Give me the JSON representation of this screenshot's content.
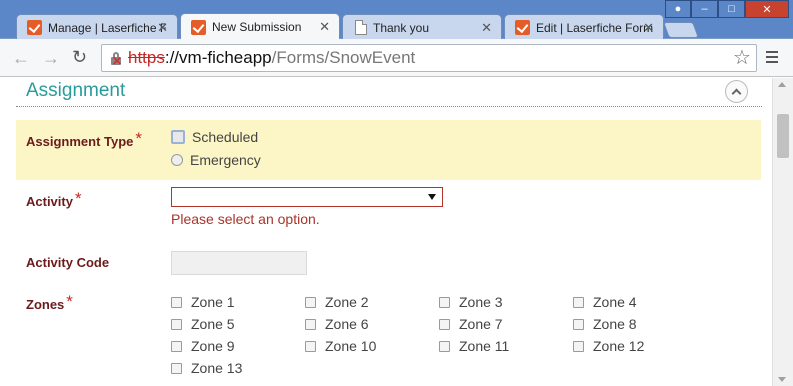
{
  "tabs": [
    {
      "title": "Manage | Laserfiche F",
      "icon": "laserfiche-check-icon"
    },
    {
      "title": "New Submission",
      "icon": "laserfiche-check-icon"
    },
    {
      "title": "Thank you",
      "icon": "document-icon"
    },
    {
      "title": "Edit | Laserfiche Form",
      "icon": "laserfiche-check-icon"
    }
  ],
  "address": {
    "scheme": "https",
    "sep": "://",
    "host": "vm-ficheapp",
    "path": "/Forms/SnowEvent"
  },
  "form": {
    "section_title": "Assignment",
    "assignment_type": {
      "label": "Assignment Type",
      "required_mark": "*",
      "options": [
        "Scheduled",
        "Emergency"
      ]
    },
    "activity": {
      "label": "Activity",
      "required_mark": "*",
      "value": "",
      "error": "Please select an option."
    },
    "activity_code": {
      "label": "Activity Code",
      "value": ""
    },
    "zones": {
      "label": "Zones",
      "required_mark": "*",
      "options": [
        "Zone 1",
        "Zone 2",
        "Zone 3",
        "Zone 4",
        "Zone 5",
        "Zone 6",
        "Zone 7",
        "Zone 8",
        "Zone 9",
        "Zone 10",
        "Zone 11",
        "Zone 12",
        "Zone 13"
      ]
    }
  },
  "colors": {
    "accent": "#2a9b9b",
    "label": "#6b1b1b",
    "required": "#c62828",
    "highlight": "#fcf6c6",
    "error": "#a8342a"
  }
}
